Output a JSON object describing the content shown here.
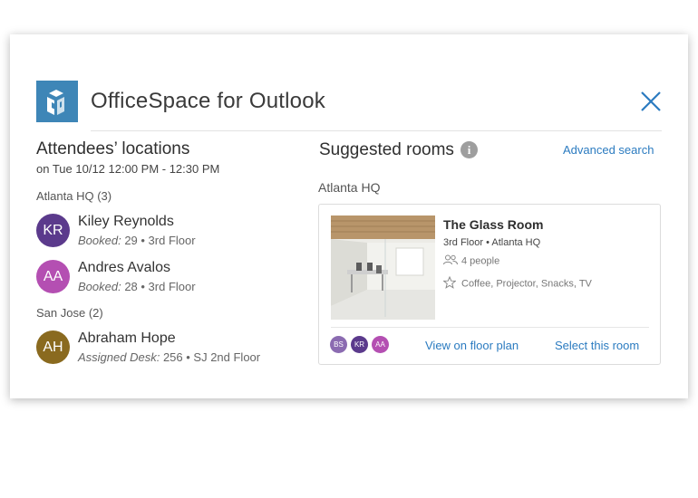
{
  "app": {
    "title": "OfficeSpace for Outlook",
    "logo_icon": "officespace-logo-icon",
    "close_icon": "close-icon"
  },
  "attendees": {
    "title": "Attendees’ locations",
    "subtitle": "on Tue 10/12 12:00 PM - 12:30 PM",
    "groups": [
      {
        "label": "Atlanta HQ (3)",
        "people": [
          {
            "initials": "KR",
            "name": "Kiley Reynolds",
            "detail_label": "Booked:",
            "detail_value": " 29 • 3rd Floor",
            "color": "#5b3a8c"
          },
          {
            "initials": "AA",
            "name": "Andres Avalos",
            "detail_label": "Booked:",
            "detail_value": " 28 • 3rd Floor",
            "color": "#b44fb2"
          }
        ]
      },
      {
        "label": "San Jose (2)",
        "people": [
          {
            "initials": "AH",
            "name": "Abraham Hope",
            "detail_label": "Assigned Desk:",
            "detail_value": " 256 • SJ 2nd Floor",
            "color": "#8a6a1f"
          }
        ]
      }
    ]
  },
  "suggested": {
    "title": "Suggested rooms",
    "info_icon": "info-icon",
    "advanced_search": "Advanced search",
    "location": "Atlanta HQ",
    "room": {
      "name": "The Glass Room",
      "location": "3rd Floor • Atlanta HQ",
      "capacity": "4 people",
      "amenities": "Coffee, Projector, Snacks, TV",
      "capacity_icon": "people-icon",
      "amenities_icon": "star-icon",
      "attendee_avatars": [
        {
          "initials": "BS",
          "color": "#8b6bb1"
        },
        {
          "initials": "KR",
          "color": "#5b3a8c"
        },
        {
          "initials": "AA",
          "color": "#b44fb2"
        }
      ],
      "view_floor_plan": "View on floor plan",
      "select_room": "Select this room"
    }
  },
  "colors": {
    "accent": "#2b7bc0",
    "logo_bg": "#3e86b7"
  }
}
